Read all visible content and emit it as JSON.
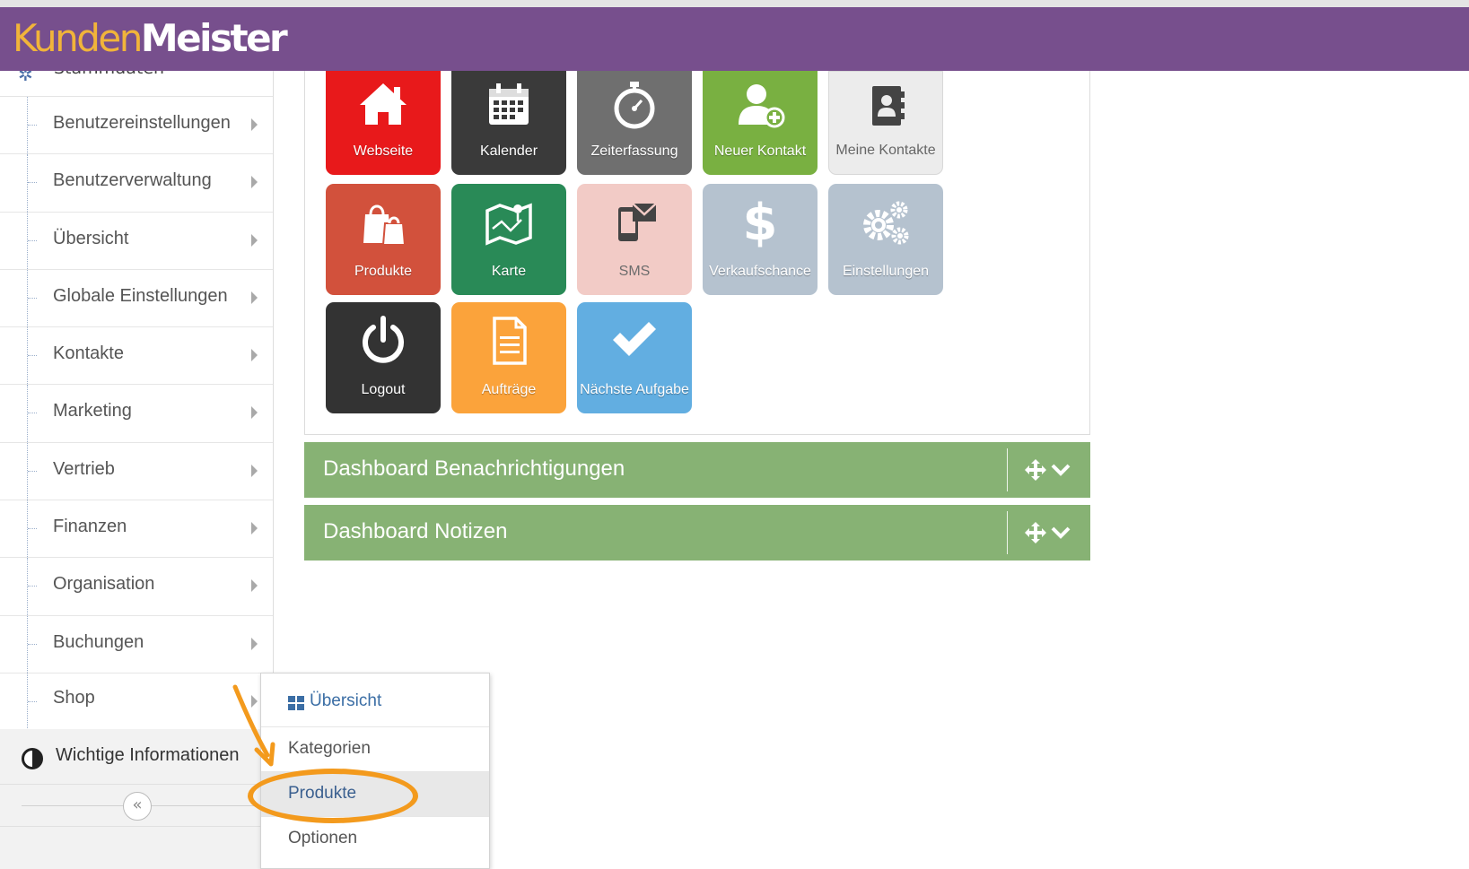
{
  "app": {
    "logo_part1": "Kunden",
    "logo_part2": "Meister",
    "colors": {
      "header": "#774f8d",
      "logo_part1": "#f1b43a",
      "accent_green": "#87b274",
      "highlight": "#f39a1d"
    }
  },
  "sidebar": {
    "partial_label": "Stammdaten",
    "items": [
      {
        "label": "Benutzereinstellungen",
        "icon": "chevron-right-icon"
      },
      {
        "label": "Benutzerverwaltung",
        "icon": "chevron-right-icon"
      },
      {
        "label": "Übersicht",
        "icon": "chevron-right-icon"
      },
      {
        "label": "Globale Einstellungen",
        "icon": "chevron-right-icon"
      },
      {
        "label": "Kontakte",
        "icon": "chevron-right-icon"
      },
      {
        "label": "Marketing",
        "icon": "chevron-right-icon"
      },
      {
        "label": "Vertrieb",
        "icon": "chevron-right-icon"
      },
      {
        "label": "Finanzen",
        "icon": "chevron-right-icon"
      },
      {
        "label": "Organisation",
        "icon": "chevron-right-icon"
      },
      {
        "label": "Buchungen",
        "icon": "chevron-right-icon"
      },
      {
        "label": "Shop",
        "icon": "chevron-right-icon"
      }
    ],
    "info_label": "Wichtige Informationen",
    "collapse_glyph": "«"
  },
  "flyout": {
    "items": [
      {
        "label": "Übersicht",
        "icon": "grid-icon"
      },
      {
        "label": "Kategorien"
      },
      {
        "label": "Produkte",
        "highlighted": true
      },
      {
        "label": "Optionen"
      }
    ]
  },
  "tiles": [
    {
      "label": "Webseite",
      "icon": "home-icon",
      "color": "#e8191b"
    },
    {
      "label": "Kalender",
      "icon": "calendar-icon",
      "color": "#3a3a3a"
    },
    {
      "label": "Zeiterfassung",
      "icon": "stopwatch-icon",
      "color": "#6f6f6f"
    },
    {
      "label": "Neuer Kontakt",
      "icon": "add-user-icon",
      "color": "#79b041"
    },
    {
      "label": "Meine Kontakte",
      "icon": "address-book-icon",
      "color": "#ececec"
    },
    {
      "label": "Produkte",
      "icon": "shopping-bags-icon",
      "color": "#d2513c"
    },
    {
      "label": "Karte",
      "icon": "map-icon",
      "color": "#298a57"
    },
    {
      "label": "SMS",
      "icon": "phone-message-icon",
      "color": "#f2cbc6"
    },
    {
      "label": "Verkaufschance",
      "icon": "dollar-icon",
      "color": "#b5c2cf"
    },
    {
      "label": "Einstellungen",
      "icon": "gears-icon",
      "color": "#b5c2cf"
    },
    {
      "label": "Logout",
      "icon": "power-icon",
      "color": "#333333"
    },
    {
      "label": "Aufträge",
      "icon": "document-icon",
      "color": "#fba33b"
    },
    {
      "label": "Nächste Aufgabe",
      "icon": "checkmark-icon",
      "color": "#62aee1"
    }
  ],
  "panels": [
    {
      "title": "Dashboard Benachrichtigungen",
      "icons": [
        "move-icon",
        "chevron-down-icon"
      ]
    },
    {
      "title": "Dashboard Notizen",
      "icons": [
        "move-icon",
        "chevron-down-icon"
      ]
    }
  ]
}
